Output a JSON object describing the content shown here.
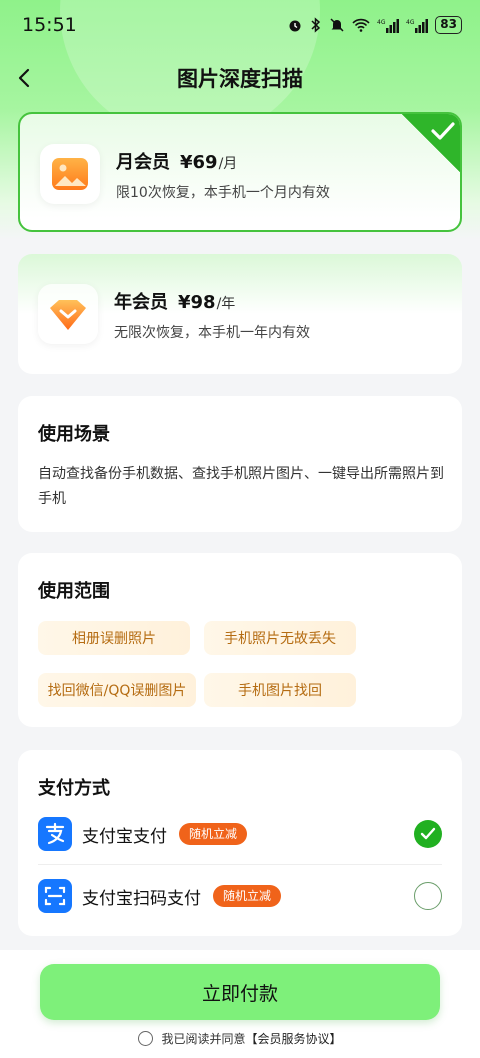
{
  "status_bar": {
    "time": "15:51",
    "battery": "83",
    "icons": [
      "alarm-icon",
      "bluetooth-icon",
      "mute-icon",
      "wifi-icon",
      "signal-4g-icon",
      "signal-4g-icon"
    ]
  },
  "nav": {
    "title": "图片深度扫描",
    "back_icon": "chevron-left-icon"
  },
  "plans": [
    {
      "name": "月会员",
      "price": "¥69",
      "unit": "/月",
      "desc": "限10次恢复，本手机一个月内有效",
      "selected": true,
      "icon": "image-icon"
    },
    {
      "name": "年会员",
      "price": "¥98",
      "unit": "/年",
      "desc": "无限次恢复，本手机一年内有效",
      "selected": false,
      "icon": "crown-badge-icon"
    }
  ],
  "scene": {
    "title": "使用场景",
    "text": "自动查找备份手机数据、查找手机照片图片、一键导出所需照片到手机"
  },
  "range": {
    "title": "使用范围",
    "tags": [
      "相册误删照片",
      "手机照片无故丢失",
      "找回微信/QQ误删图片",
      "手机图片找回"
    ]
  },
  "payment": {
    "title": "支付方式",
    "methods": [
      {
        "name": "支付宝支付",
        "badge": "随机立减",
        "selected": true,
        "icon": "alipay-icon"
      },
      {
        "name": "支付宝扫码支付",
        "badge": "随机立减",
        "selected": false,
        "icon": "alipay-scan-icon"
      }
    ]
  },
  "bottom": {
    "pay_button": "立即付款",
    "agree_text": "我已阅读并同意",
    "agree_link": "【会员服务协议】"
  },
  "colors": {
    "accent_green": "#7ef07a",
    "selected_green": "#21b021",
    "badge_orange": "#f0631a",
    "tag_text": "#b56c12"
  }
}
